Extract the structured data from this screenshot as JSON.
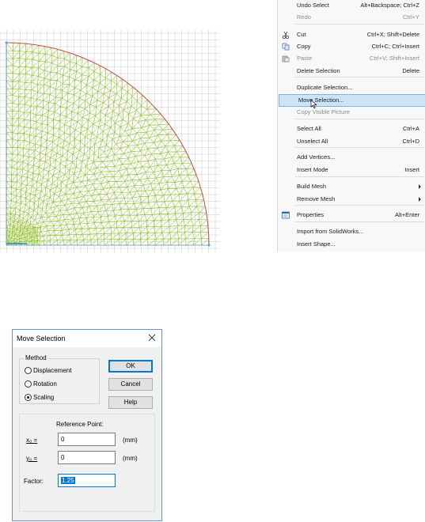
{
  "context_menu": {
    "items": [
      {
        "label": "Undo Select",
        "shortcut": "Alt+Backspace; Ctrl+Z",
        "disabled": false
      },
      {
        "label": "Redo",
        "shortcut": "Ctrl+Y",
        "disabled": true
      },
      {
        "label": "Cut",
        "shortcut": "Ctrl+X; Shift+Delete",
        "icon": "scissors-icon"
      },
      {
        "label": "Copy",
        "shortcut": "Ctrl+C; Ctrl+Insert",
        "icon": "copy-icon"
      },
      {
        "label": "Paste",
        "shortcut": "Ctrl+V; Shift+Insert",
        "disabled": true,
        "icon": "paste-icon"
      },
      {
        "label": "Delete Selection",
        "shortcut": "Delete"
      },
      {
        "label": "Duplicate Selection..."
      },
      {
        "label": "Move Selection...",
        "highlighted": true
      },
      {
        "label": "Copy Visible Picture",
        "disabled": true
      },
      {
        "label": "Select All",
        "shortcut": "Ctrl+A"
      },
      {
        "label": "Unselect All",
        "shortcut": "Ctrl+D"
      },
      {
        "label": "Add Vertices..."
      },
      {
        "label": "Insert Mode",
        "shortcut": "Insert"
      },
      {
        "label": "Build Mesh",
        "submenu": true
      },
      {
        "label": "Remove Mesh",
        "submenu": true
      },
      {
        "label": "Properties",
        "shortcut": "Alt+Enter",
        "icon": "properties-icon"
      },
      {
        "label": "Import from SolidWorks..."
      },
      {
        "label": "Insert Shape..."
      }
    ]
  },
  "dialog": {
    "title": "Move Selection",
    "method_label": "Method",
    "methods": [
      {
        "label": "Displacement",
        "checked": false
      },
      {
        "label": "Rotation",
        "checked": false
      },
      {
        "label": "Scaling",
        "checked": true
      }
    ],
    "ok_label": "OK",
    "cancel_label": "Cancel",
    "help_label": "Help",
    "reference_label": "Reference Point:",
    "x0_label": "x₀ =",
    "y0_label": "y₀ =",
    "x0_value": "0",
    "y0_value": "0",
    "unit": "(mm)",
    "factor_label": "Factor:",
    "factor_value": "1.25"
  },
  "colors": {
    "mesh": "#8dc21f",
    "arc": "#c0504d",
    "grid": "#c8c8c8",
    "menu_highlight": "#cce4f7",
    "selection": "#0078d7"
  }
}
